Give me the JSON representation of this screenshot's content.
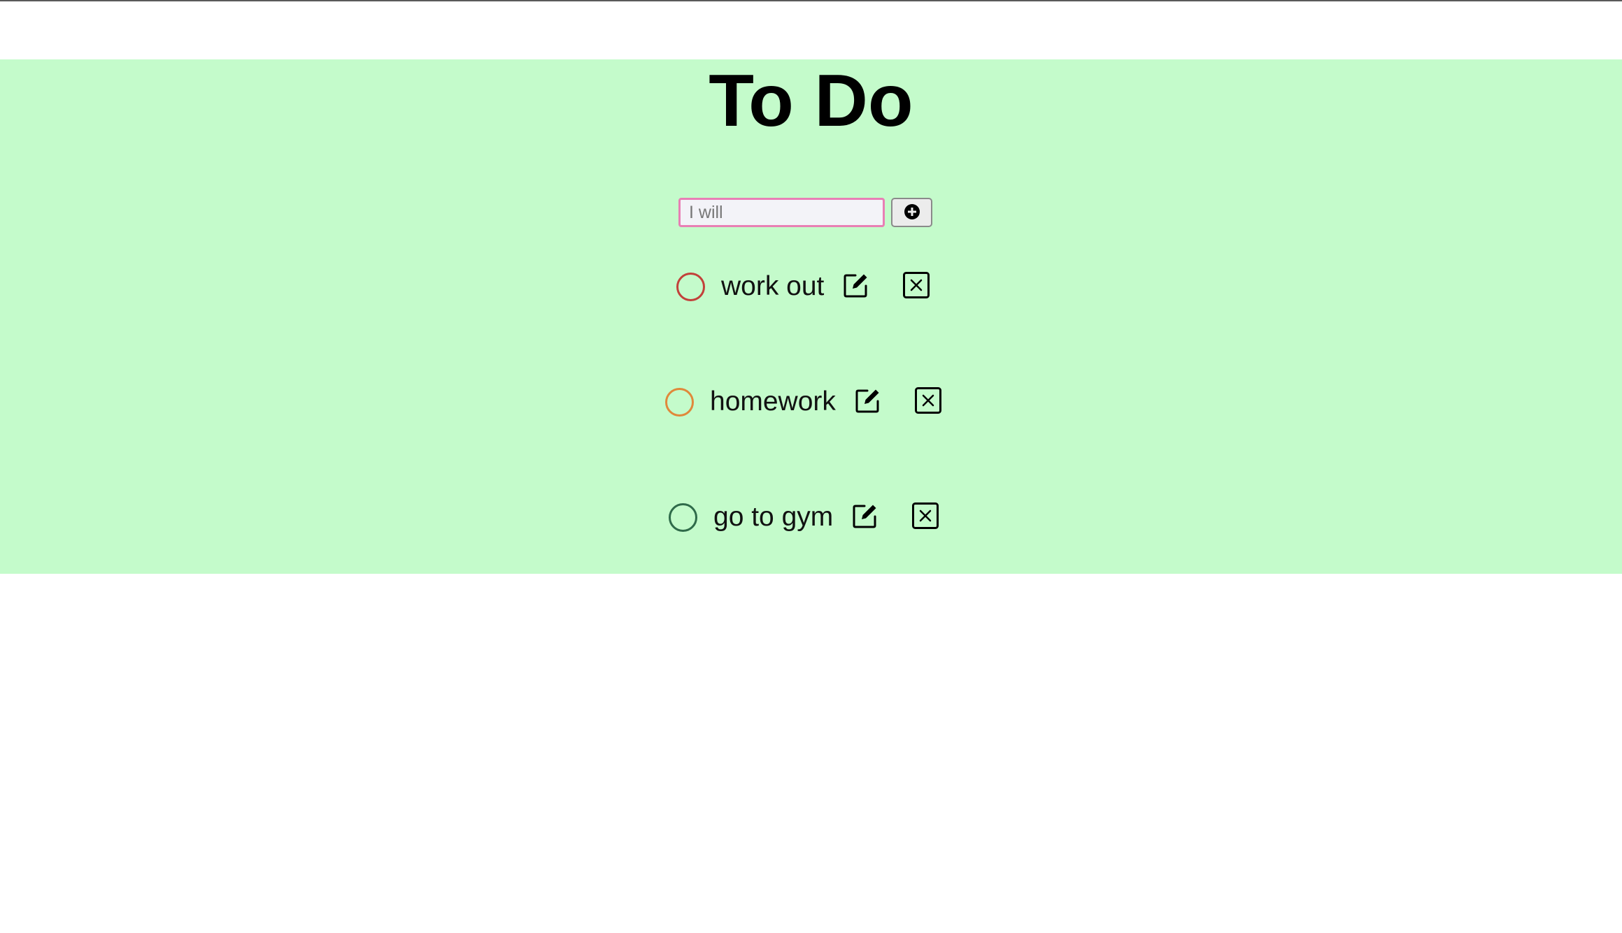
{
  "header": {
    "title": "To Do"
  },
  "new_task": {
    "placeholder": "I will",
    "value": "",
    "add_button_icon": "plus-circle-icon"
  },
  "todos": [
    {
      "label": "work out",
      "status_color": "#c2413a",
      "completed": false
    },
    {
      "label": "homework",
      "status_color": "#e0883a",
      "completed": false
    },
    {
      "label": "go to gym",
      "status_color": "#2f6b4a",
      "completed": false
    }
  ],
  "icons": {
    "edit": "edit-square-icon",
    "delete": "close-square-icon"
  },
  "colors": {
    "app_background": "#c4fbcb",
    "input_focus_border": "#e87fb5"
  }
}
